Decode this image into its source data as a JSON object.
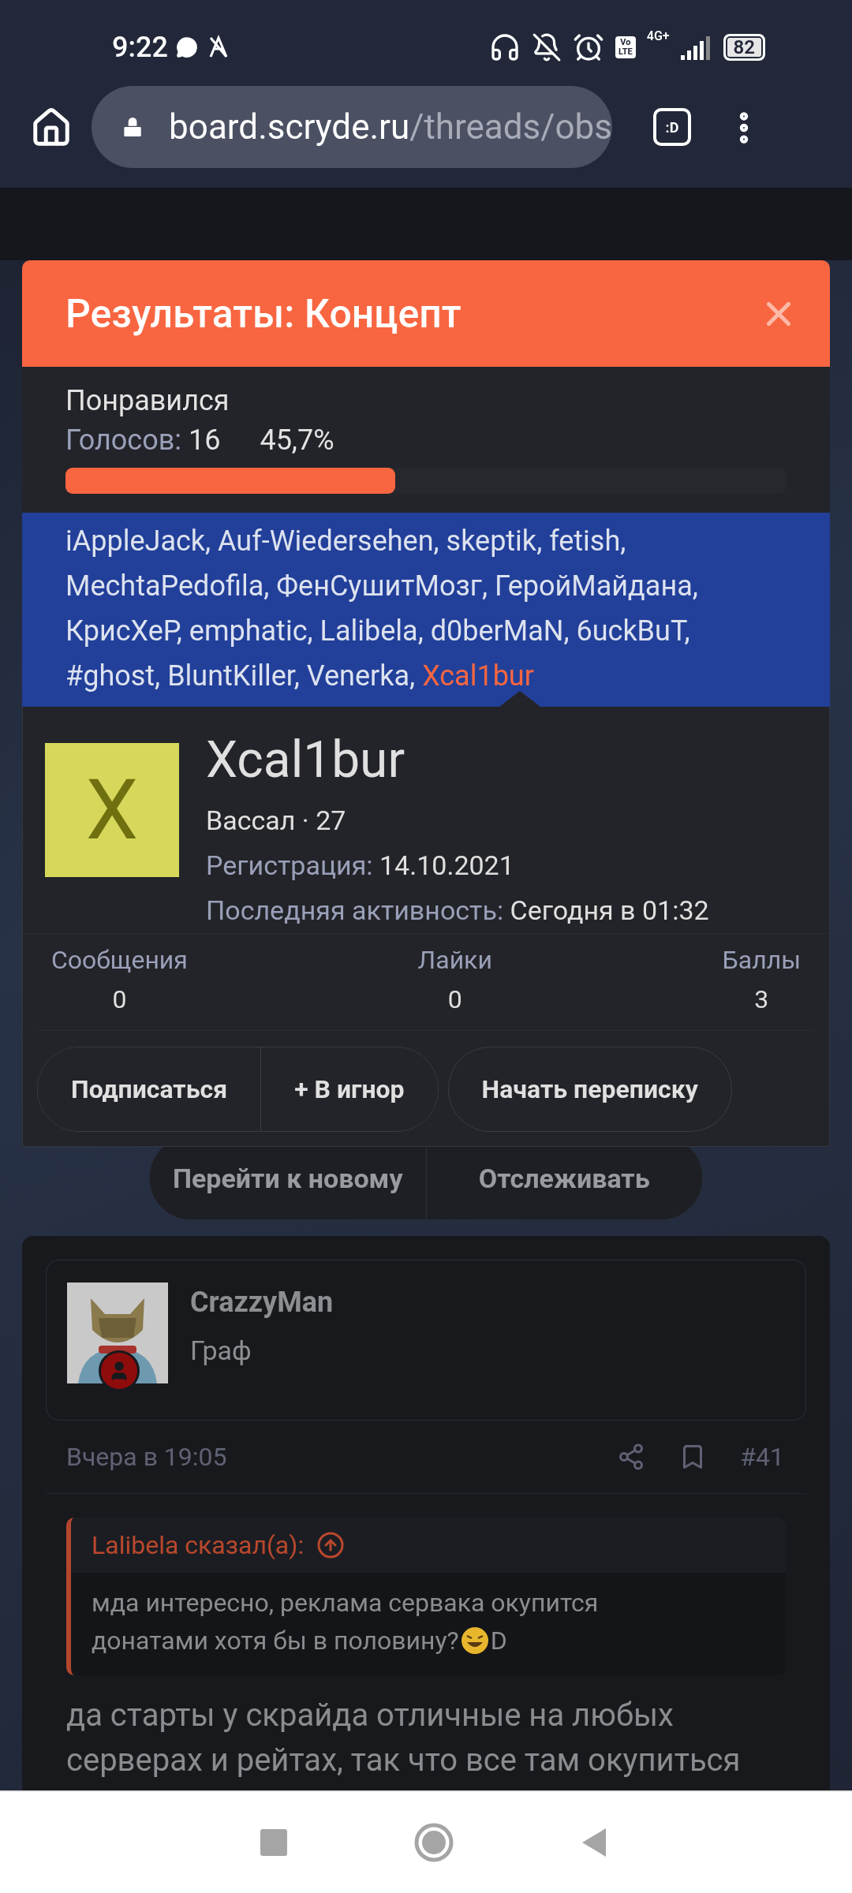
{
  "status_bar": {
    "time": "9:22",
    "network": "4G+",
    "volte": [
      "Vo",
      "LTE"
    ],
    "battery": "82"
  },
  "browser": {
    "url_host": "board.scryde.ru",
    "url_path": "/threads/obs",
    "tab_button": ":D"
  },
  "backdrop": {
    "buttons": [
      "Перейти к новому",
      "Отслеживать"
    ],
    "post": {
      "author": "CrazzyMan",
      "role": "Граф",
      "time": "Вчера в 19:05",
      "number": "#41",
      "quote_author": "Lalibela сказал(а):",
      "quote_lines": [
        "мда интересно, реклама сервака окупится",
        "донатами хотя бы в половину?"
      ],
      "quote_tail": "D",
      "body": "да старты у скрайда отличные на любых серверах и рейтах, так что все там окупиться"
    }
  },
  "modal": {
    "title": "Результаты: Концепт",
    "option": {
      "label": "Понравился",
      "votes_label": "Голосов:",
      "votes": "16",
      "percent": "45,7%",
      "level": 0.457
    },
    "voter_separator": ",",
    "voters": [
      {
        "name": "iAppleJack",
        "selected": false
      },
      {
        "name": "Auf-Wiedersehen",
        "selected": false
      },
      {
        "name": "skeptik",
        "selected": false
      },
      {
        "name": "fetish",
        "selected": false
      },
      {
        "name": "MechtaPedofila",
        "selected": false
      },
      {
        "name": "ФенСушитМозг",
        "selected": false
      },
      {
        "name": "ГеройМайдана",
        "selected": false
      },
      {
        "name": "КрисХеР",
        "selected": false
      },
      {
        "name": "emphatic",
        "selected": false
      },
      {
        "name": "Lalibela",
        "selected": false
      },
      {
        "name": "d0berMaN",
        "selected": false
      },
      {
        "name": "6uckBuT",
        "selected": false
      },
      {
        "name": "#ghost",
        "selected": false
      },
      {
        "name": "BluntKiller",
        "selected": false
      },
      {
        "name": "Venerka",
        "selected": false
      },
      {
        "name": "Xcal1bur",
        "selected": true
      }
    ],
    "profile": {
      "avatar_letter": "X",
      "name": "Xcal1bur",
      "rank": "Вассал · 27",
      "registration_label": "Регистрация:",
      "registration": "14.10.2021",
      "activity_label": "Последняя активность:",
      "activity": "Сегодня в 01:32",
      "stats": [
        {
          "label": "Сообщения",
          "value": "0"
        },
        {
          "label": "Лайки",
          "value": "0"
        },
        {
          "label": "Баллы",
          "value": "3"
        }
      ],
      "buttons": [
        "Подписаться",
        "+ В игнор",
        "Начать переписку"
      ]
    }
  }
}
